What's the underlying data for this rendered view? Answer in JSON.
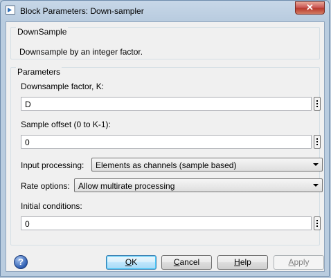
{
  "window": {
    "title": "Block Parameters: Down-sampler",
    "close_symbol": "✕"
  },
  "block": {
    "name": "DownSample",
    "description": "Downsample by an integer factor."
  },
  "parameters": {
    "title": "Parameters",
    "downsample_factor": {
      "label": "Downsample factor, K:",
      "value": "D"
    },
    "sample_offset": {
      "label": "Sample offset (0 to K-1):",
      "value": "0"
    },
    "input_processing": {
      "label": "Input processing:",
      "value": "Elements as channels (sample based)"
    },
    "rate_options": {
      "label": "Rate options:",
      "value": "Allow multirate processing"
    },
    "initial_conditions": {
      "label": "Initial conditions:",
      "value": "0"
    }
  },
  "buttons": {
    "help_icon": "?",
    "ok_mnemonic": "O",
    "ok_rest": "K",
    "cancel_mnemonic": "C",
    "cancel_rest": "ancel",
    "help_mnemonic": "H",
    "help_rest": "elp",
    "apply_mnemonic": "A",
    "apply_rest": "pply"
  },
  "icons": {
    "app": "simulink-block-icon",
    "close": "close-icon",
    "help": "help-icon",
    "edit": "vertical-dots-icon",
    "dropdown": "chevron-down-icon"
  }
}
